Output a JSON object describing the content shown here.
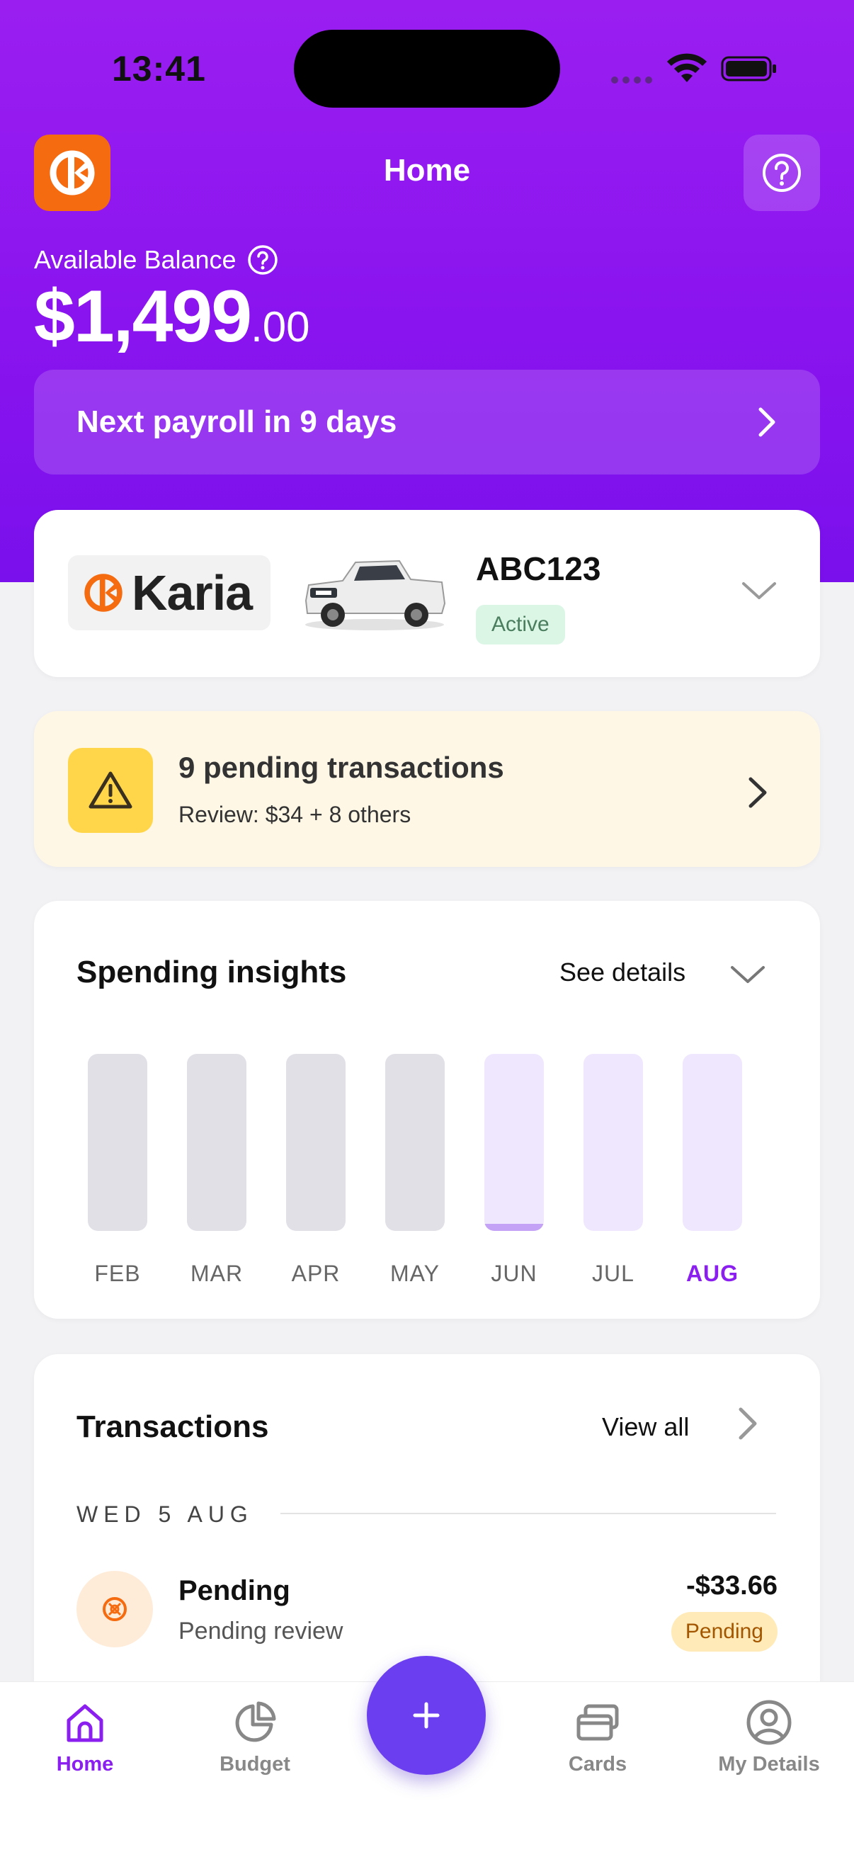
{
  "status_bar": {
    "time": "13:41"
  },
  "header": {
    "title": "Home"
  },
  "balance": {
    "label": "Available Balance",
    "dollars": "$1,499",
    "cents": ".00"
  },
  "payroll": {
    "text": "Next payroll in 9 days"
  },
  "vehicle": {
    "brand": "Karia",
    "plate": "ABC123",
    "status": "Active"
  },
  "pending": {
    "title": "9 pending transactions",
    "subtitle": "Review:  $34 + 8 others"
  },
  "insights": {
    "title": "Spending insights",
    "link": "See details",
    "months": [
      {
        "label": "FEB",
        "fill": 0,
        "selected": false,
        "future": false
      },
      {
        "label": "MAR",
        "fill": 0,
        "selected": false,
        "future": false
      },
      {
        "label": "APR",
        "fill": 0,
        "selected": false,
        "future": false
      },
      {
        "label": "MAY",
        "fill": 0,
        "selected": false,
        "future": false
      },
      {
        "label": "JUN",
        "fill": 0.04,
        "selected": false,
        "future": true
      },
      {
        "label": "JUL",
        "fill": 0,
        "selected": false,
        "future": true
      },
      {
        "label": "AUG",
        "fill": 0,
        "selected": true,
        "future": true
      }
    ],
    "colors": {
      "track_past": "#e2e0e7",
      "track_current": "#efe7fd",
      "fill": "#c4a2f5",
      "selected_label": "#8b1ff0"
    }
  },
  "transactions": {
    "title": "Transactions",
    "link": "View all",
    "date_group": "WED 5 AUG",
    "items": [
      {
        "name": "Pending",
        "sub": "Pending review",
        "amount": "-$33.66",
        "badge": "Pending"
      }
    ]
  },
  "tabbar": {
    "items": [
      {
        "label": "Home",
        "icon": "home-icon",
        "selected": true
      },
      {
        "label": "Budget",
        "icon": "pie-chart-icon",
        "selected": false
      },
      {
        "label": "Cards",
        "icon": "cards-icon",
        "selected": false
      },
      {
        "label": "My Details",
        "icon": "user-circle-icon",
        "selected": false
      }
    ],
    "fab_icon": "plus-icon"
  },
  "colors": {
    "brand_purple": "#8b1ff0",
    "brand_orange": "#f56b10",
    "warning_yellow": "#ffd64a"
  }
}
